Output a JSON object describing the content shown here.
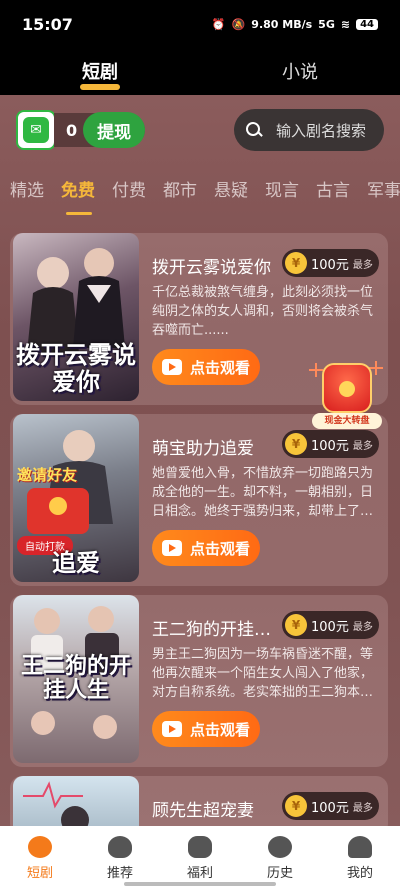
{
  "status_bar": {
    "time": "15:07",
    "net_speed": "9.80 MB/s",
    "signal": "5G",
    "battery": "44"
  },
  "top_tabs": [
    {
      "label": "短剧",
      "active": true
    },
    {
      "label": "小说",
      "active": false
    }
  ],
  "wallet": {
    "balance": "0",
    "withdraw_label": "提现"
  },
  "search": {
    "placeholder": "输入剧名搜索"
  },
  "category_tabs": [
    "精选",
    "免费",
    "付费",
    "都市",
    "悬疑",
    "现言",
    "古言",
    "军事"
  ],
  "active_category": "免费",
  "dramas": [
    {
      "title": "拨开云雾说爱你",
      "cover_text": "拨开云雾说爱你",
      "reward_amount": "100元",
      "reward_suffix": "最多",
      "description": "千亿总裁被煞气缠身，此刻必须找一位纯阴之体的女人调和，否则将会被杀气吞噬而亡......",
      "watch_label": "点击观看"
    },
    {
      "title": "萌宝助力追爱",
      "cover_text": "追爱",
      "reward_amount": "100元",
      "reward_suffix": "最多",
      "description": "她曾爱他入骨，不惜放弃一切跑路只为成全他的一生。却不料，一朝相别，日日相念。她终于强势归来，却带上了…",
      "watch_label": "点击观看",
      "overlay_invite": "邀请好友",
      "overlay_auto": "自动打款"
    },
    {
      "title": "王二狗的开挂人生",
      "cover_text": "王二狗的开挂人生",
      "reward_amount": "100元",
      "reward_suffix": "最多",
      "description": "男主王二狗因为一场车祸昏迷不醒，等他再次醒来一个陌生女人闯入了他家，对方自称系统。老实笨拙的王二狗本…",
      "watch_label": "点击观看"
    },
    {
      "title": "顾先生超宠妻",
      "cover_text": "",
      "reward_amount": "100元",
      "reward_suffix": "最多",
      "description": "",
      "watch_label": ""
    }
  ],
  "lucky_widget": {
    "label": "现金大转盘"
  },
  "bottom_nav": [
    {
      "label": "短剧",
      "icon": "film-reel-icon",
      "active": true
    },
    {
      "label": "推荐",
      "icon": "flame-icon",
      "active": false
    },
    {
      "label": "福利",
      "icon": "money-bag-icon",
      "active": false
    },
    {
      "label": "历史",
      "icon": "clock-icon",
      "active": false
    },
    {
      "label": "我的",
      "icon": "user-icon",
      "active": false
    }
  ],
  "colors": {
    "accent": "#f5b73a",
    "button_orange": "#ff6a14",
    "wechat_green": "#2fb842"
  }
}
